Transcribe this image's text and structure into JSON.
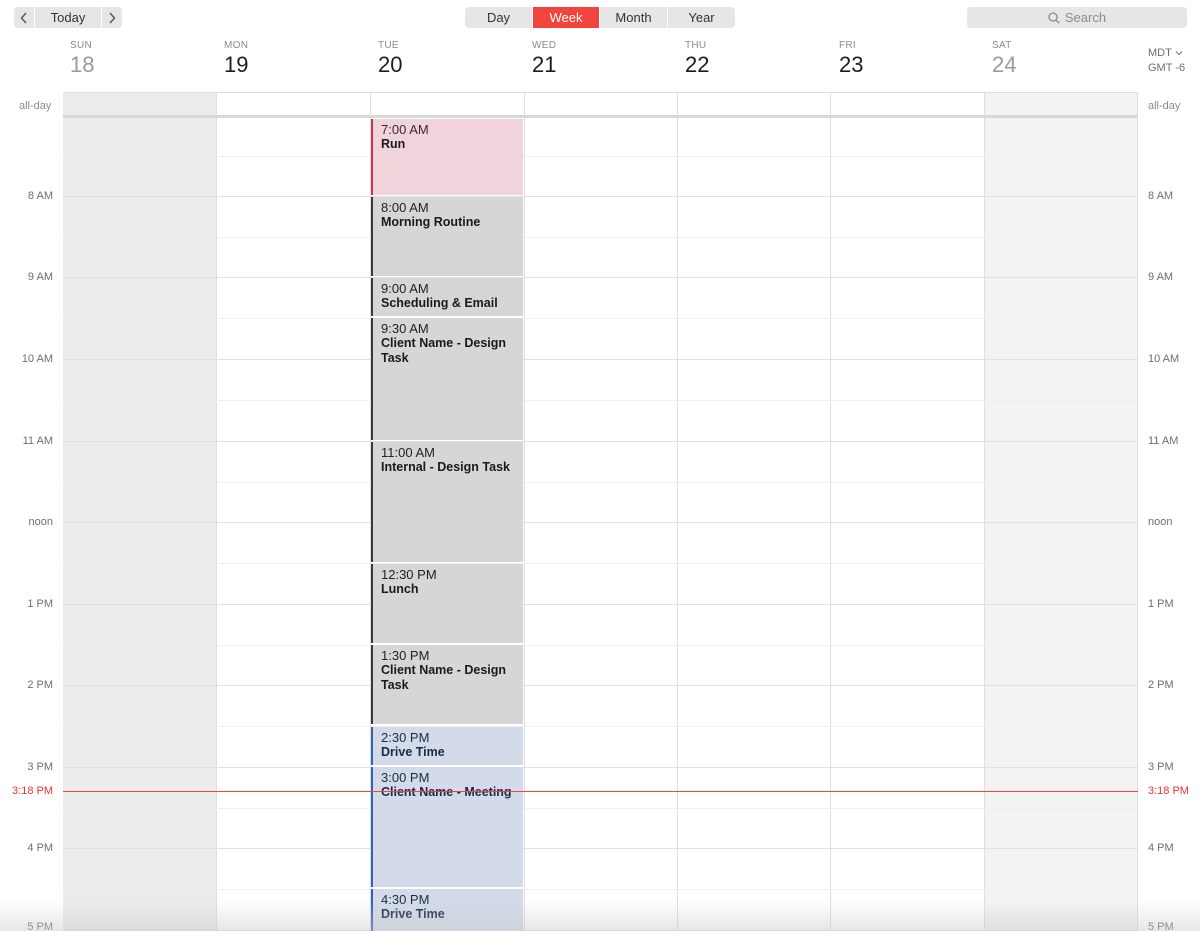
{
  "toolbar": {
    "prev_icon": "chevron-left-icon",
    "today_label": "Today",
    "next_icon": "chevron-right-icon",
    "views": [
      "Day",
      "Week",
      "Month",
      "Year"
    ],
    "active_view": "Week",
    "search_placeholder": "Search",
    "search_icon": "magnifier-icon"
  },
  "week": {
    "days": [
      {
        "name": "SUN",
        "number": "18",
        "weekend": true
      },
      {
        "name": "MON",
        "number": "19",
        "weekend": false
      },
      {
        "name": "TUE",
        "number": "20",
        "weekend": false
      },
      {
        "name": "WED",
        "number": "21",
        "weekend": false
      },
      {
        "name": "THU",
        "number": "22",
        "weekend": false
      },
      {
        "name": "FRI",
        "number": "23",
        "weekend": false
      },
      {
        "name": "SAT",
        "number": "24",
        "weekend": true
      }
    ],
    "timezone_line1": "MDT",
    "timezone_line2": "GMT -6",
    "allday_label": "all-day"
  },
  "hours": [
    "8 AM",
    "9 AM",
    "10 AM",
    "11 AM",
    "noon",
    "1 PM",
    "2 PM",
    "3 PM",
    "4 PM",
    "5 PM"
  ],
  "current_time": "3:18 PM",
  "events": [
    {
      "time": "7:00 AM",
      "title": "Run",
      "color": "pink"
    },
    {
      "time": "8:00 AM",
      "title": "Morning Routine",
      "color": "gray"
    },
    {
      "time": "9:00 AM",
      "title": "Scheduling & Email",
      "color": "gray"
    },
    {
      "time": "9:30 AM",
      "title": "Client Name - Design Task",
      "color": "gray"
    },
    {
      "time": "11:00 AM",
      "title": "Internal - Design Task",
      "color": "gray"
    },
    {
      "time": "12:30 PM",
      "title": "Lunch",
      "color": "gray"
    },
    {
      "time": "1:30 PM",
      "title": "Client Name - Design Task",
      "color": "gray"
    },
    {
      "time": "2:30 PM",
      "title": "Drive Time",
      "color": "blue"
    },
    {
      "time": "3:00 PM",
      "title": "Client Name - Meeting",
      "color": "blue"
    },
    {
      "time": "4:30 PM",
      "title": "Drive Time",
      "color": "blue"
    }
  ],
  "colors": {
    "accent": "#f0443c",
    "pink_event": "#f1d3dc",
    "gray_event": "#d6d6d6",
    "blue_event": "#d3dbea"
  }
}
